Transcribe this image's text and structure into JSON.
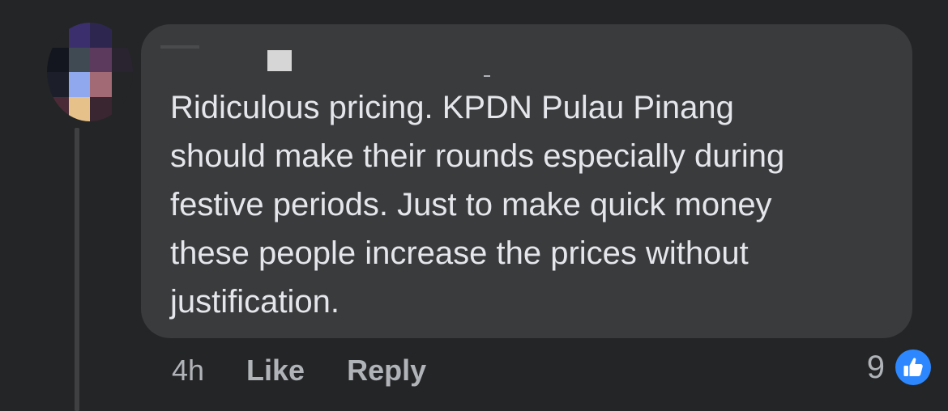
{
  "comment": {
    "author_name": "",
    "text": "Ridiculous pricing. KPDN Pulau Pinang\nshould make their rounds especially during\nfestive periods. Just to make quick money\nthese people increase the prices without\njustification."
  },
  "actions": {
    "time": "4h",
    "like_label": "Like",
    "reply_label": "Reply"
  },
  "reactions": {
    "count": "9",
    "icon": "like-thumbs-up-icon"
  },
  "colors": {
    "background": "#242526",
    "bubble": "#3a3b3c",
    "text": "#e4e6eb",
    "muted": "#b0b3b8",
    "like_blue": "#2d88ff"
  }
}
